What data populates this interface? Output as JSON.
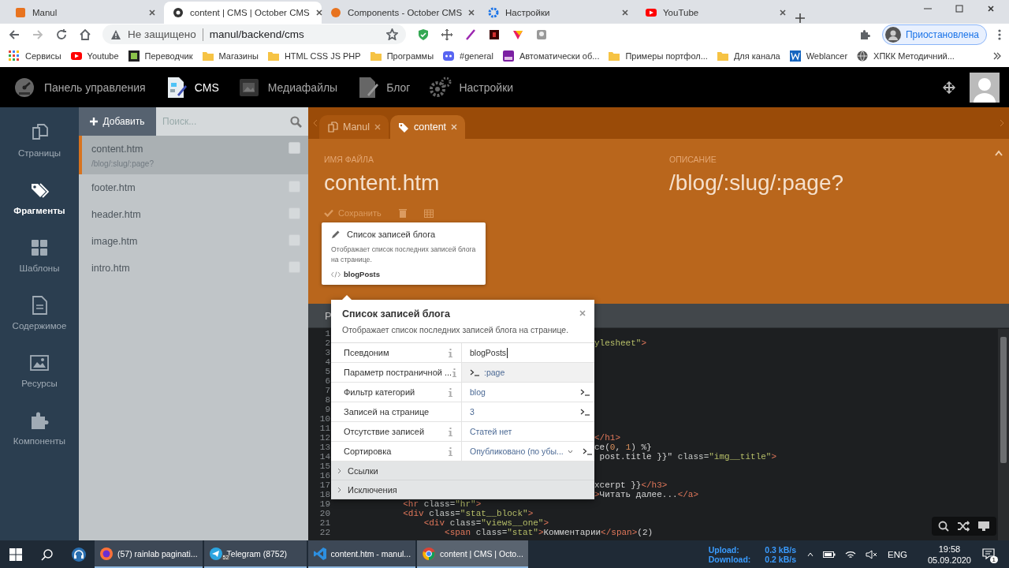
{
  "browser": {
    "tabs": [
      {
        "title": "Manul",
        "selected": false
      },
      {
        "title": "content | CMS | October CMS",
        "selected": true
      },
      {
        "title": "Components - October CMS",
        "selected": false
      },
      {
        "title": "Настройки",
        "selected": false
      },
      {
        "title": "YouTube",
        "selected": false
      }
    ],
    "address": {
      "security": "Не защищено",
      "url": "manul/backend/cms"
    },
    "profile": "Приостановлена",
    "bookmarks": [
      "Сервисы",
      "Youtube",
      "Переводчик",
      "Магазины",
      "HTML CSS JS PHP",
      "Программы",
      "#general",
      "Автоматически об...",
      "Примеры портфол...",
      "Для канала",
      "Weblancer",
      "ХПКК Методичний..."
    ]
  },
  "topnav": {
    "items": [
      {
        "label": "Панель управления",
        "selected": false
      },
      {
        "label": "CMS",
        "selected": true
      },
      {
        "label": "Медиафайлы",
        "selected": false
      },
      {
        "label": "Блог",
        "selected": false
      },
      {
        "label": "Настройки",
        "selected": false
      }
    ]
  },
  "sidebar": {
    "items": [
      {
        "label": "Страницы",
        "selected": false
      },
      {
        "label": "Фрагменты",
        "selected": true
      },
      {
        "label": "Шаблоны",
        "selected": false
      },
      {
        "label": "Содержимое",
        "selected": false
      },
      {
        "label": "Ресурсы",
        "selected": false
      },
      {
        "label": "Компоненты",
        "selected": false
      }
    ]
  },
  "file_list": {
    "add_button": "Добавить",
    "search": {
      "placeholder": "Поиск..."
    },
    "items": [
      {
        "name": "content.htm",
        "subtitle": "/blog/:slug/:page?",
        "selected": true,
        "checked": false
      },
      {
        "name": "footer.htm",
        "selected": false,
        "checked": false
      },
      {
        "name": "header.htm",
        "selected": false,
        "checked": false
      },
      {
        "name": "image.htm",
        "selected": false,
        "checked": false
      },
      {
        "name": "intro.htm",
        "selected": false,
        "checked": false
      }
    ]
  },
  "editor": {
    "tabs": [
      {
        "label": "Manul",
        "selected": false
      },
      {
        "label": "content",
        "selected": true
      }
    ],
    "filename_label": "ИМЯ ФАЙЛА",
    "filename": "content.htm",
    "description_label": "ОПИСАНИЕ",
    "description": "/blog/:slug/:page?",
    "save_button": "Сохранить",
    "code_header": "Р",
    "code_lines": [
      {
        "number": "1"
      },
      {
        "number": "2",
        "kind": "clipped",
        "tokens": [
          {
            "kind": "str",
            "text": "ylesheet\""
          },
          {
            "kind": "tag",
            "text": ">"
          }
        ]
      },
      {
        "number": "3"
      },
      {
        "number": "4"
      },
      {
        "number": "5"
      },
      {
        "number": "6"
      },
      {
        "number": "7"
      },
      {
        "number": "8"
      },
      {
        "number": "9"
      },
      {
        "number": "10"
      },
      {
        "number": "11"
      },
      {
        "number": "12",
        "kind": "clipped",
        "tokens": [
          {
            "kind": "tag",
            "text": "</h1>"
          }
        ]
      },
      {
        "number": "13",
        "kind": "clipped",
        "tokens": [
          {
            "kind": "plain",
            "text": "ce("
          },
          {
            "kind": "num",
            "text": "0"
          },
          {
            "kind": "plain",
            "text": ", "
          },
          {
            "kind": "num",
            "text": "1"
          },
          {
            "kind": "plain",
            "text": ") %}"
          }
        ]
      },
      {
        "number": "14",
        "kind": "clipped",
        "tokens": [
          {
            "kind": "plain",
            "text": " post.title }}\""
          },
          {
            "kind": "attr",
            "text": " class="
          },
          {
            "kind": "str",
            "text": "\"img__title\""
          },
          {
            "kind": "tag",
            "text": ">"
          }
        ]
      },
      {
        "number": "15"
      },
      {
        "number": "16"
      },
      {
        "number": "17",
        "kind": "clipped",
        "tokens": [
          {
            "kind": "plain",
            "text": "xcerpt }}"
          },
          {
            "kind": "tag",
            "text": "</h3>"
          }
        ]
      },
      {
        "number": "18",
        "kind": "clipped",
        "tokens": [
          {
            "kind": "tag",
            "text": ">"
          },
          {
            "kind": "plain",
            "text": "Читать далее..."
          },
          {
            "kind": "tag",
            "text": "</a>"
          }
        ]
      },
      {
        "number": "19",
        "kind": "full",
        "tokens": [
          {
            "kind": "tag",
            "text": "            <hr"
          },
          {
            "kind": "attr",
            "text": " class="
          },
          {
            "kind": "str",
            "text": "\"hr\""
          },
          {
            "kind": "tag",
            "text": ">"
          }
        ]
      },
      {
        "number": "20",
        "kind": "full",
        "tokens": [
          {
            "kind": "tag",
            "text": "            <div"
          },
          {
            "kind": "attr",
            "text": " class="
          },
          {
            "kind": "str",
            "text": "\"stat__block\""
          },
          {
            "kind": "tag",
            "text": ">"
          }
        ]
      },
      {
        "number": "21",
        "kind": "full",
        "tokens": [
          {
            "kind": "tag",
            "text": "                <div"
          },
          {
            "kind": "attr",
            "text": " class="
          },
          {
            "kind": "str",
            "text": "\"views__one\""
          },
          {
            "kind": "tag",
            "text": ">"
          }
        ]
      },
      {
        "number": "22",
        "kind": "full",
        "tokens": [
          {
            "kind": "tag",
            "text": "                    <span"
          },
          {
            "kind": "attr",
            "text": " class="
          },
          {
            "kind": "str",
            "text": "\"stat\""
          },
          {
            "kind": "tag",
            "text": ">"
          },
          {
            "kind": "plain",
            "text": "Комментарии"
          },
          {
            "kind": "tag",
            "text": "</span>"
          },
          {
            "kind": "plain",
            "text": "(2)"
          }
        ]
      }
    ]
  },
  "component_card": {
    "title": "Список записей блога",
    "description": "Отображает список последних записей блога на странице.",
    "alias": "blogPosts"
  },
  "inspector": {
    "title": "Список записей блога",
    "description": "Отображает список последних записей блога на странице.",
    "properties": [
      {
        "label": "Псевдоним",
        "info": true,
        "kind": "text",
        "value": "blogPosts",
        "focused": true,
        "switch": false
      },
      {
        "label": "Параметр постраничной ...",
        "info": true,
        "kind": "dynamic",
        "value": ":page",
        "focused": false,
        "switch": false
      },
      {
        "label": "Фильтр категорий",
        "info": true,
        "kind": "text",
        "value": "blog",
        "focused": false,
        "switch": true
      },
      {
        "label": "Записей на странице",
        "info": false,
        "kind": "text",
        "value": "3",
        "focused": false,
        "switch": true
      },
      {
        "label": "Отсутствие записей",
        "info": true,
        "kind": "text",
        "value": "Статей нет",
        "focused": false,
        "switch": false
      },
      {
        "label": "Сортировка",
        "info": true,
        "kind": "dropdown",
        "value": "Опубликовано (по убы...",
        "focused": false,
        "switch": true
      }
    ],
    "groups": [
      {
        "label": "Ссылки",
        "expanded": false
      },
      {
        "label": "Исключения",
        "expanded": false
      }
    ]
  },
  "taskbar": {
    "apps": [
      {
        "label": "(57) rainlab paginati...",
        "selected": false
      },
      {
        "label": "Telegram (8752)",
        "badge": "52",
        "selected": false
      },
      {
        "label": "content.htm - manul...",
        "selected": false
      },
      {
        "label": "content | CMS | Octo...",
        "selected": true
      }
    ],
    "network": {
      "upload_label": "Upload:",
      "upload": "0.3 kB/s",
      "download_label": "Download:",
      "download": "0.2 kB/s"
    },
    "language": "ENG",
    "time": "19:58",
    "date": "05.09.2020",
    "notifications": "1"
  }
}
